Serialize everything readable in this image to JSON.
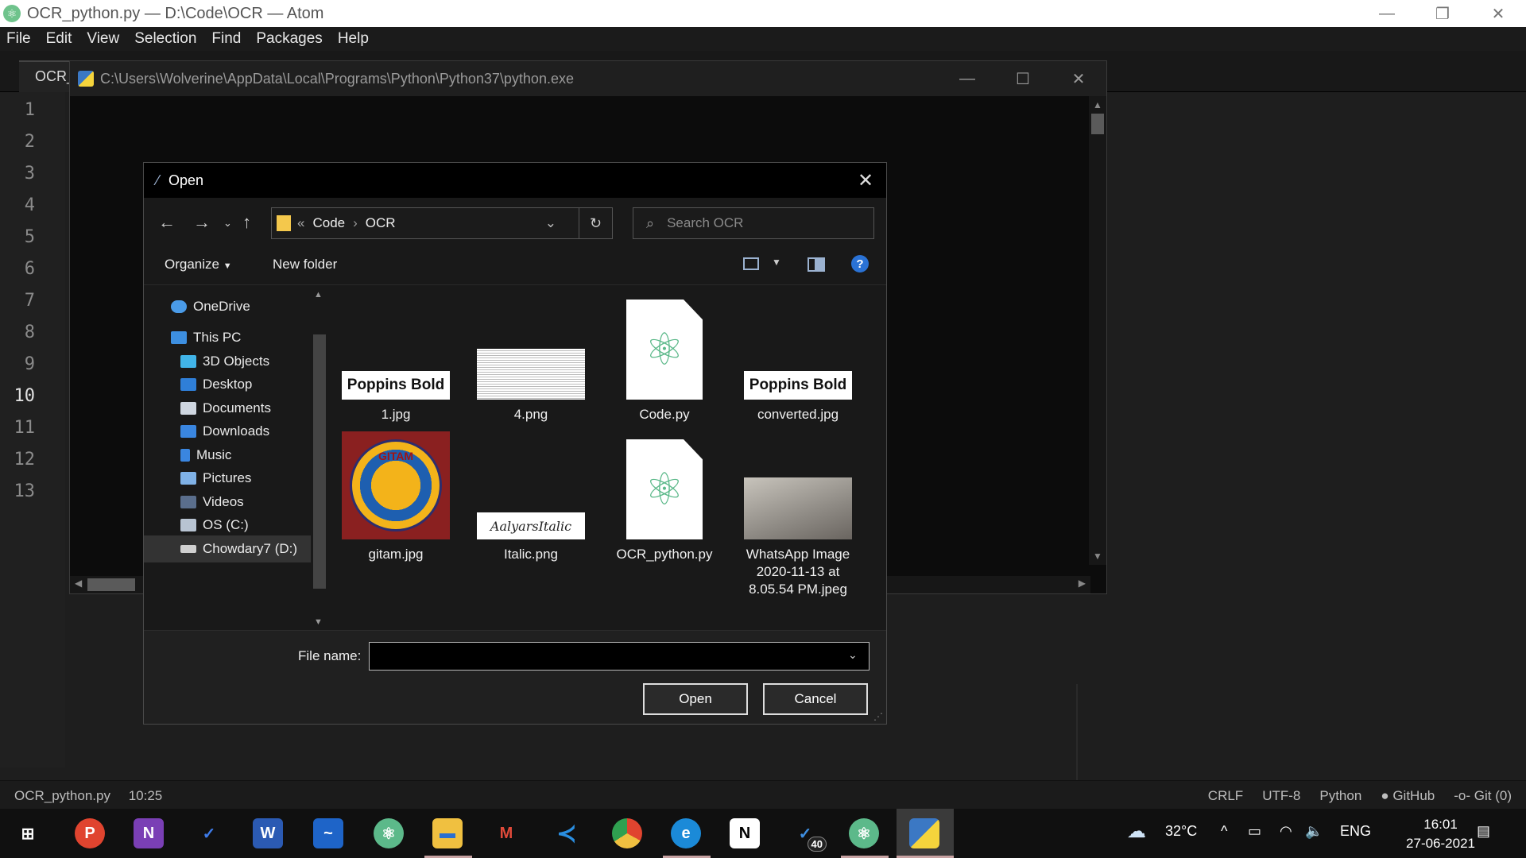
{
  "atom": {
    "window_title": "OCR_python.py — D:\\Code\\OCR — Atom",
    "menu": [
      "File",
      "Edit",
      "View",
      "Selection",
      "Find",
      "Packages",
      "Help"
    ],
    "tab_label": "OCR_",
    "line_numbers": [
      "1",
      "2",
      "3",
      "4",
      "5",
      "6",
      "7",
      "8",
      "9",
      "10",
      "11",
      "12",
      "13"
    ],
    "active_line": "10",
    "status": {
      "file": "OCR_python.py",
      "cursor": "10:25",
      "line_ending": "CRLF",
      "encoding": "UTF-8",
      "grammar": "Python",
      "github": "GitHub",
      "git": "Git (0)"
    }
  },
  "console": {
    "title": "C:\\Users\\Wolverine\\AppData\\Local\\Programs\\Python\\Python37\\python.exe"
  },
  "dialog": {
    "title": "Open",
    "breadcrumb": [
      "Code",
      "OCR"
    ],
    "breadcrumb_prefix": "«",
    "search_placeholder": "Search OCR",
    "organize_label": "Organize",
    "new_folder_label": "New folder",
    "nav_items": [
      {
        "label": "OneDrive",
        "icon": "cloud-icon"
      },
      {
        "label": "This PC",
        "icon": "computer-icon"
      },
      {
        "label": "3D Objects",
        "icon": "cube-icon"
      },
      {
        "label": "Desktop",
        "icon": "desktop-icon"
      },
      {
        "label": "Documents",
        "icon": "documents-icon"
      },
      {
        "label": "Downloads",
        "icon": "download-icon"
      },
      {
        "label": "Music",
        "icon": "music-icon"
      },
      {
        "label": "Pictures",
        "icon": "pictures-icon"
      },
      {
        "label": "Videos",
        "icon": "videos-icon"
      },
      {
        "label": "OS (C:)",
        "icon": "drive-icon"
      },
      {
        "label": "Chowdary7 (D:)",
        "icon": "drive-icon"
      }
    ],
    "selected_nav": "Chowdary7 (D:)",
    "files": [
      {
        "name": "1.jpg",
        "thumb_text": "Poppins Bold"
      },
      {
        "name": "4.png"
      },
      {
        "name": "Code.py"
      },
      {
        "name": "converted.jpg",
        "thumb_text": "Poppins Bold"
      },
      {
        "name": "gitam.jpg",
        "thumb_text": "GITAM"
      },
      {
        "name": "Italic.png",
        "thumb_text": "AalyarsItalic"
      },
      {
        "name": "OCR_python.py"
      },
      {
        "name": "WhatsApp Image 2020-11-13 at 8.05.54 PM.jpeg"
      }
    ],
    "filename_label": "File name:",
    "filename_value": "",
    "open_label": "Open",
    "cancel_label": "Cancel"
  },
  "taskbar": {
    "badge_count": "40",
    "weather": "32°C",
    "language": "ENG",
    "time": "16:01",
    "date": "27-06-2021"
  }
}
